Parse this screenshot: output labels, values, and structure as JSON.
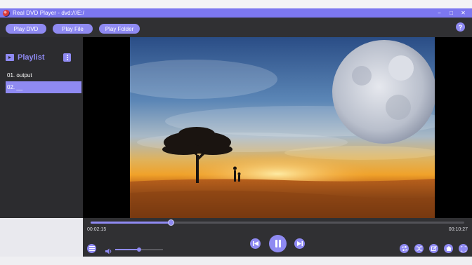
{
  "window": {
    "title": "Real DVD Player - dvd:///E:/",
    "minimize_glyph": "−",
    "maximize_glyph": "□",
    "close_glyph": "✕"
  },
  "toolbar": {
    "play_dvd": "Play DVD",
    "play_file": "Play File",
    "play_folder": "Play Folder",
    "help": "?"
  },
  "playlist": {
    "title": "Playlist",
    "items": [
      {
        "label": "01. output"
      },
      {
        "label": "02. __"
      }
    ],
    "selected_index": 1
  },
  "playback": {
    "current_time": "00:02:15",
    "total_time": "00:10:27",
    "progress_percent": 21.5,
    "volume_percent": 50
  },
  "colors": {
    "accent": "#8f8af2",
    "titlebar": "#7c77f0",
    "panel": "#2c2c2f"
  }
}
